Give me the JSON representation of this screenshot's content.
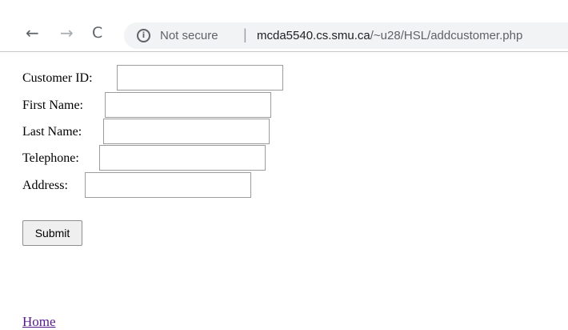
{
  "browser": {
    "back_icon": "arrow-left",
    "back_glyph": "←",
    "forward_icon": "arrow-right",
    "forward_glyph": "→",
    "reload_icon": "reload",
    "reload_glyph": "C",
    "info_icon": "info-circle",
    "info_glyph": "i",
    "security_label": "Not secure",
    "separator": "|",
    "url_host": "mcda5540.cs.smu.ca",
    "url_path": "/~u28/HSL/addcustomer.php"
  },
  "form": {
    "fields": [
      {
        "label": "Customer ID:",
        "value": ""
      },
      {
        "label": "First Name:",
        "value": ""
      },
      {
        "label": "Last Name:",
        "value": ""
      },
      {
        "label": "Telephone:",
        "value": ""
      },
      {
        "label": "Address:",
        "value": ""
      }
    ],
    "submit_label": "Submit"
  },
  "footer": {
    "home_link": "Home"
  },
  "colors": {
    "link_visited": "#551a8b",
    "url_bar_bg": "#f1f3f4"
  }
}
